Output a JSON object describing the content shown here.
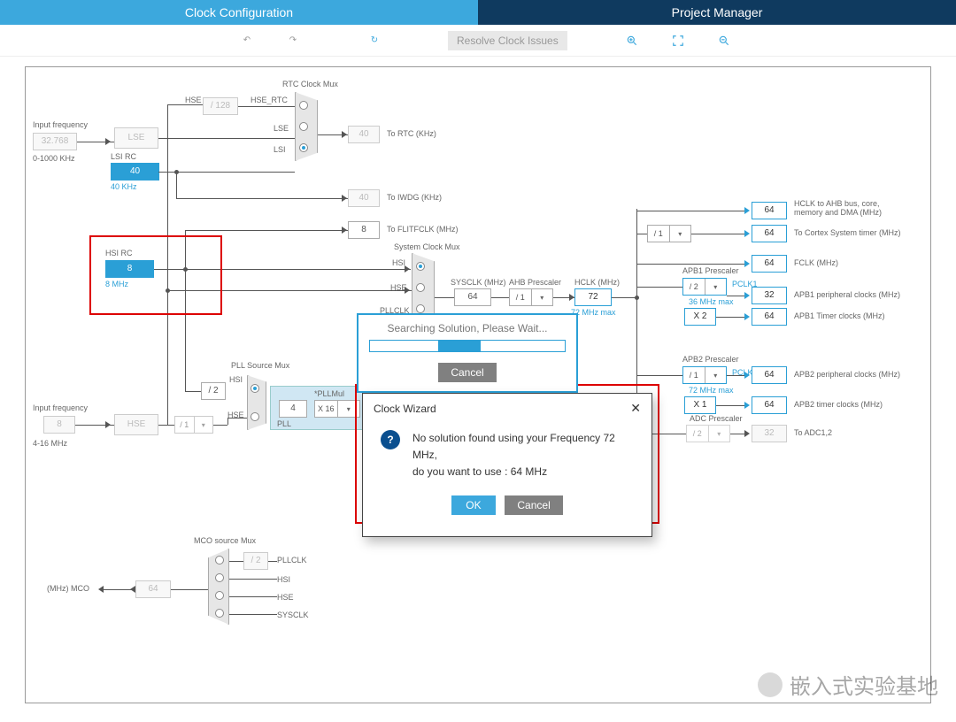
{
  "tabs": {
    "clock": "Clock Configuration",
    "project": "Project Manager"
  },
  "toolbar": {
    "resolve": "Resolve Clock Issues"
  },
  "diagram": {
    "input_freq_top_lbl": "Input frequency",
    "input_freq_top_val": "32.768",
    "input_freq_top_range": "0-1000 KHz",
    "lse": "LSE",
    "lsi_rc": "LSI RC",
    "lsi_val": "40",
    "lsi_hz": "40 KHz",
    "hsi_rc": "HSI RC",
    "hsi_val": "8",
    "hsi_hz": "8 MHz",
    "input_freq_bot_lbl": "Input frequency",
    "input_freq_bot_val": "8",
    "input_freq_bot_range": "4-16 MHz",
    "hse_lbl": "HSE",
    "hse_div": "/ 1",
    "hse_div2": "/ 2",
    "hse_sig": "HSE",
    "hsi_sig": "HSI",
    "lse_sig": "LSE",
    "lsi_sig": "LSI",
    "div128": "/ 128",
    "hse_rtc": "HSE_RTC",
    "rtc_mux": "RTC Clock Mux",
    "to_rtc": "To RTC (KHz)",
    "rtc_val": "40",
    "to_iwdg": "To IWDG (KHz)",
    "iwdg_val": "40",
    "to_flitf": "To FLITFCLK (MHz)",
    "flitf_val": "8",
    "sys_mux": "System Clock Mux",
    "pllclk": "PLLCLK",
    "sysclk_lbl": "SYSCLK (MHz)",
    "sysclk_val": "64",
    "ahb_lbl": "AHB Prescaler",
    "ahb_div": "/ 1",
    "hclk_lbl": "HCLK (MHz)",
    "hclk_val": "72",
    "hclk_max": "72 MHz max",
    "apb1_prescaler": "APB1 Prescaler",
    "apb1_div": "/ 2",
    "apb1_max": "36 MHz max",
    "apb1_x2": "X 2",
    "apb2_prescaler": "APB2 Prescaler",
    "apb2_div": "/ 1",
    "apb2_max": "72 MHz max",
    "apb2_x1": "X 1",
    "adc_prescaler": "ADC Prescaler",
    "adc_div": "/ 2",
    "pclk1": "PCLK1",
    "pclk2": "PCLK2",
    "hclk_out": "64",
    "hclk_out_lbl": "HCLK to AHB bus, core, memory and DMA (MHz)",
    "cortex_out": "64",
    "cortex_lbl": "To Cortex System timer (MHz)",
    "fclk_out": "64",
    "fclk_lbl": "FCLK (MHz)",
    "apb1p_out": "32",
    "apb1p_lbl": "APB1 peripheral clocks (MHz)",
    "apb1t_out": "64",
    "apb1t_lbl": "APB1 Timer clocks (MHz)",
    "apb2p_out": "64",
    "apb2p_lbl": "APB2 peripheral clocks (MHz)",
    "apb2t_out": "64",
    "apb2t_lbl": "APB2 timer clocks (MHz)",
    "adc_out": "32",
    "adc_lbl": "To ADC1,2",
    "pll_src_mux": "PLL Source Mux",
    "pll_mul": "*PLLMul",
    "pll_val": "4",
    "pll_x": "X 16",
    "pll_lbl": "PLL",
    "mco_mux": "MCO source Mux",
    "mco_div": "/ 2",
    "mco_val": "64",
    "mco_lbl": "(MHz) MCO",
    "mco_pllclk": "PLLCLK",
    "mco_hsi": "HSI",
    "mco_hse": "HSE",
    "mco_sysclk": "SYSCLK"
  },
  "search": {
    "msg": "Searching Solution, Please Wait...",
    "cancel": "Cancel"
  },
  "wizard": {
    "title": "Clock Wizard",
    "msg1": "No solution found using your Frequency 72 MHz,",
    "msg2": "do you want to use :   64 MHz",
    "ok": "OK",
    "cancel": "Cancel"
  },
  "watermark": "嵌入式实验基地"
}
